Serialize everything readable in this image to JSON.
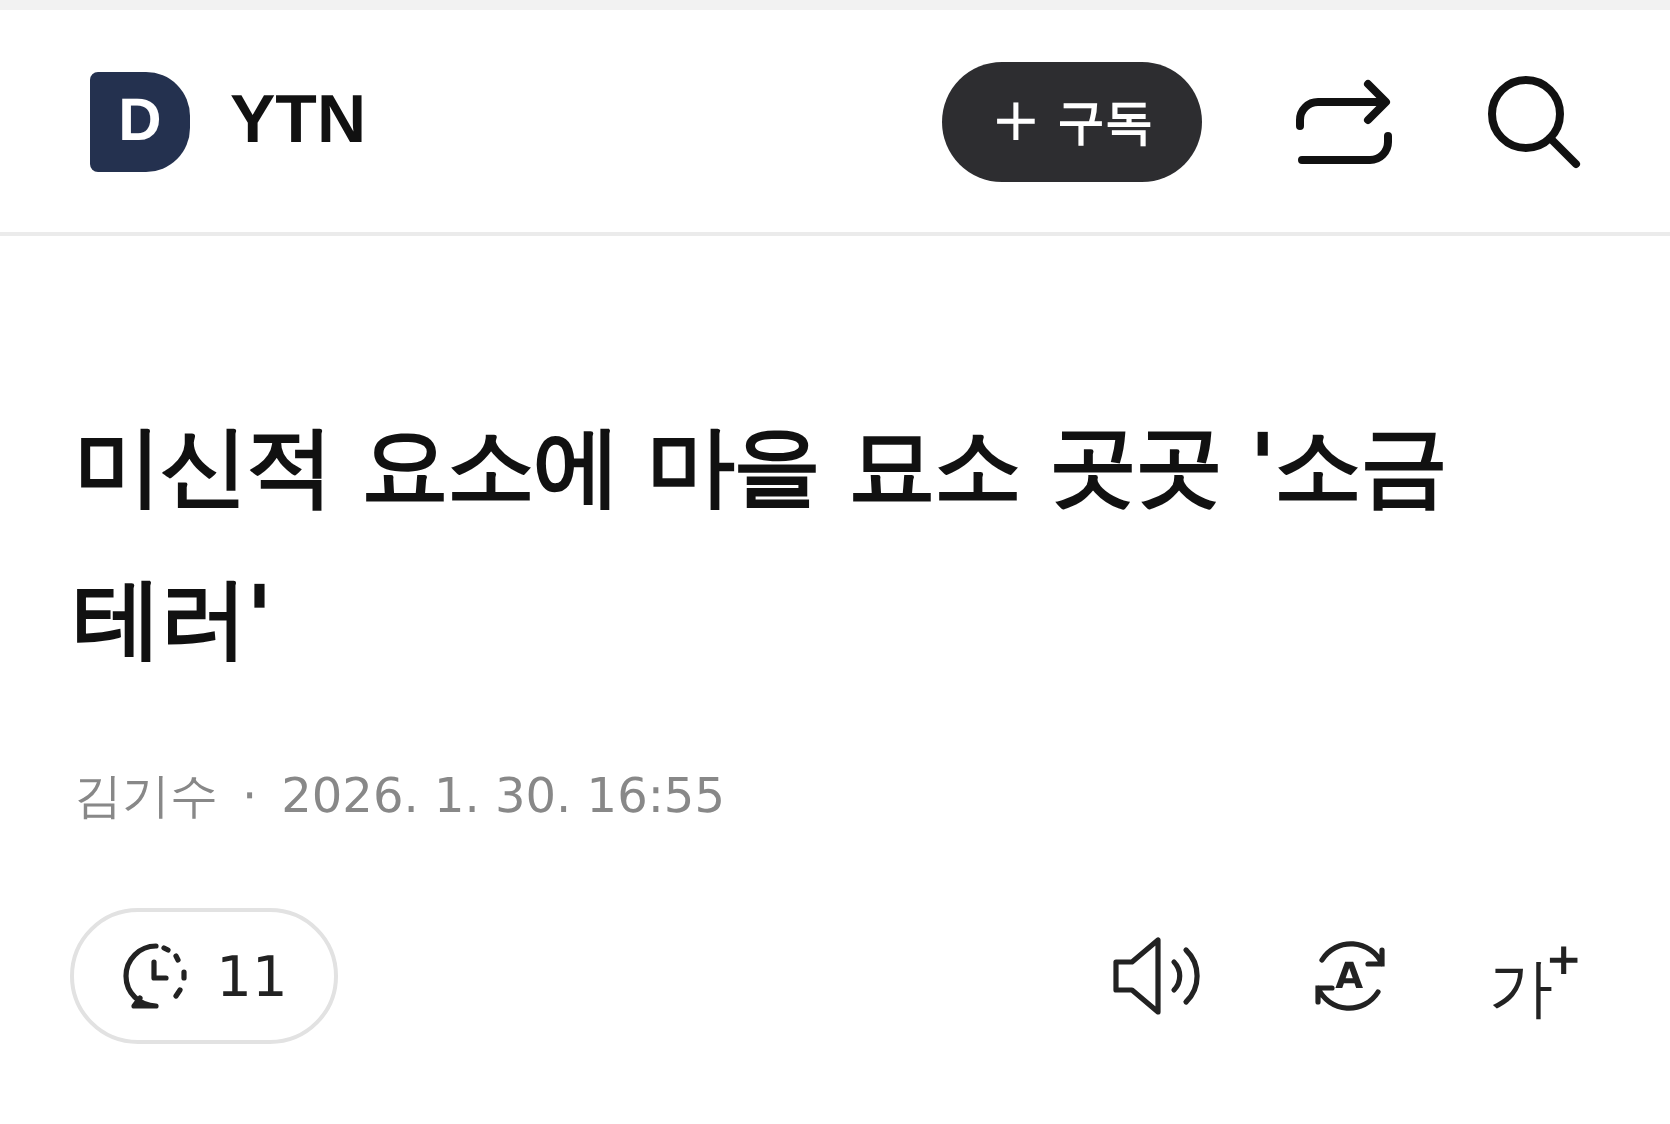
{
  "header": {
    "logo_letter": "D",
    "brand": "YTN",
    "subscribe_button": {
      "icon": "+",
      "label": "구독"
    }
  },
  "article": {
    "title": "미신적 요소에 마을 묘소 곳곳 '소금 테러'",
    "author": "김기수",
    "separator": "·",
    "date": "2026. 1. 30. 16:55"
  },
  "toolbar": {
    "comments_count": "11",
    "translate_letter": "A",
    "font_size": {
      "label": "가",
      "plus": "+"
    }
  }
}
